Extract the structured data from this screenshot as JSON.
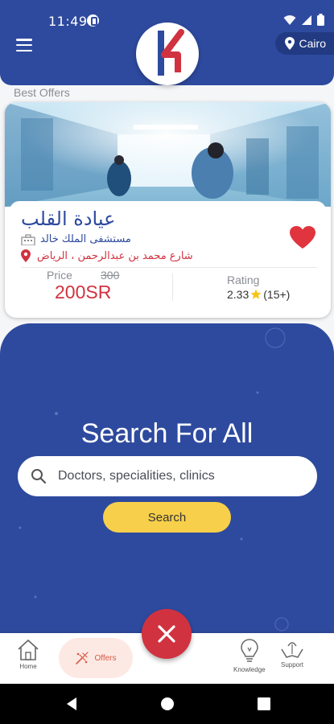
{
  "status_bar": {
    "time": "11:49"
  },
  "header": {
    "location": "Cairo"
  },
  "section_title": "Best Offers",
  "offer": {
    "title": "عيادة القلب",
    "hospital": "مستشفى الملك خالد",
    "address": "شارع محمد بن عبدالرحمن ، الرياض",
    "price_label": "Price",
    "old_price": "300",
    "new_price": "200SR",
    "rating_label": "Rating",
    "rating_value": "2.33",
    "rating_count": "(15+)",
    "favorite": true
  },
  "search": {
    "heading": "Search For All",
    "placeholder": "Doctors, specialities, clinics",
    "button_label": "Search"
  },
  "bottom_nav": {
    "home": "Home",
    "offers": "Offers",
    "knowledge": "Knowledge",
    "support": "Support"
  },
  "colors": {
    "primary": "#2e4a9e",
    "accent_red": "#d13240",
    "button_yellow": "#f7cf4a",
    "offers_pill": "#fde9e4"
  },
  "icons": [
    "hamburger-icon",
    "location-pin-icon",
    "building-icon",
    "map-pin-icon",
    "heart-icon",
    "star-icon",
    "search-icon",
    "home-icon",
    "offers-icon",
    "close-icon",
    "knowledge-icon",
    "support-icon"
  ]
}
